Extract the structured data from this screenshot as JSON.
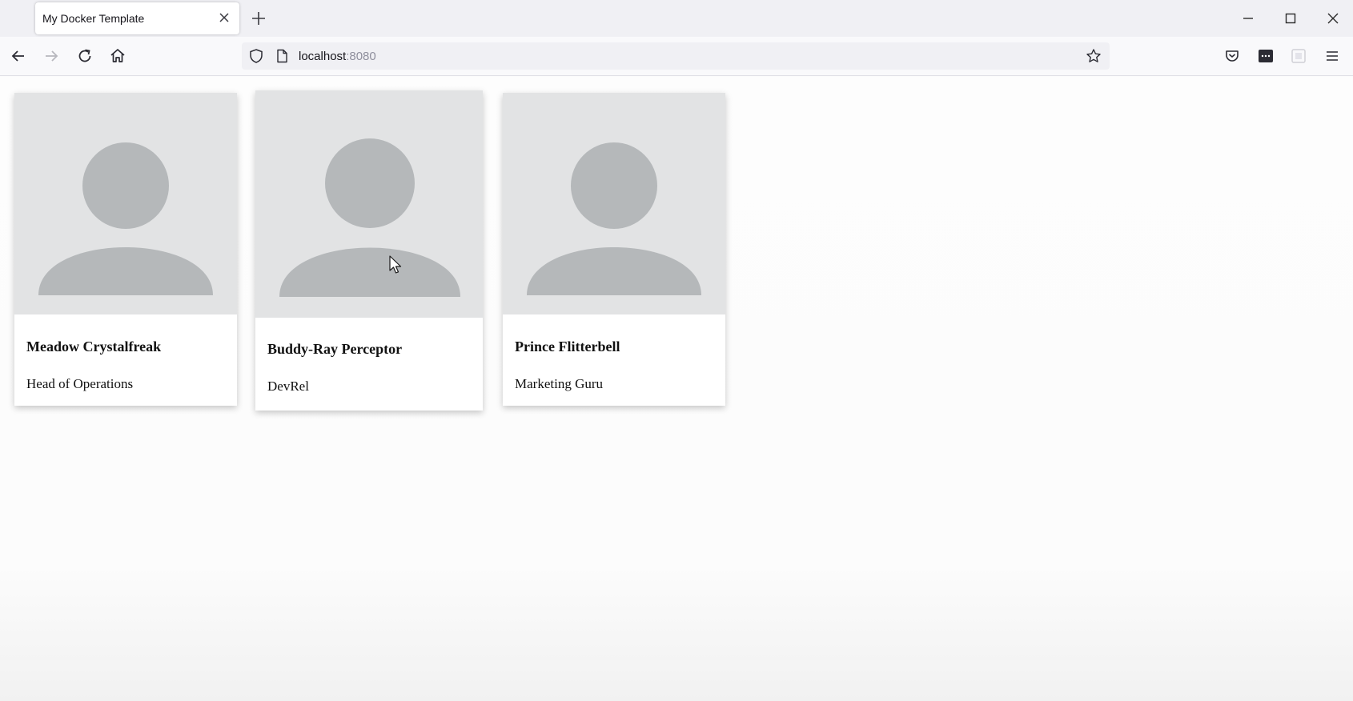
{
  "browser": {
    "tab_title": "My Docker Template",
    "url_host": "localhost",
    "url_port": ":8080"
  },
  "team": [
    {
      "name": "Meadow Crystalfreak",
      "role": "Head of Operations",
      "avatar_icon": "person-placeholder-icon"
    },
    {
      "name": "Buddy-Ray Perceptor",
      "role": "DevRel",
      "avatar_icon": "person-placeholder-icon"
    },
    {
      "name": "Prince Flitterbell",
      "role": "Marketing Guru",
      "avatar_icon": "person-placeholder-icon"
    }
  ],
  "colors": {
    "avatar_bg": "#e2e3e4",
    "avatar_fg": "#b5b8ba",
    "page_bg": "#fcfcfc"
  }
}
